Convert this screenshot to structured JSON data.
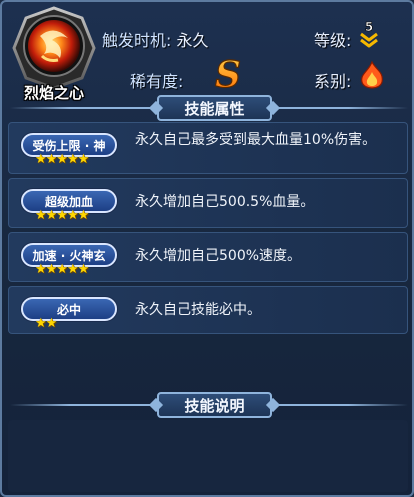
{
  "skill": {
    "name": "烈焰之心",
    "icon": "fire-orb-icon"
  },
  "header": {
    "trigger_label": "触发时机:",
    "trigger_value": "永久",
    "level_label": "等级:",
    "level_value": "5",
    "rarity_label": "稀有度:",
    "rarity_value": "S",
    "series_label": "系别:",
    "series_icon": "fire-element-icon"
  },
  "sections": {
    "attributes_title": "技能属性",
    "description_title": "技能说明"
  },
  "attributes": [
    {
      "name": "受伤上限 · 神",
      "stars": "★★★★★",
      "star_count": 5,
      "desc": "永久自己最多受到最大血量10%伤害。"
    },
    {
      "name": "超级加血",
      "stars": "★★★★★",
      "star_count": 5,
      "desc": "永久增加自己500.5%血量。"
    },
    {
      "name": "加速 · 火神玄",
      "stars": "★★★★★",
      "star_count": 5,
      "desc": "永久增加自己500%速度。"
    },
    {
      "name": "必中",
      "stars": "★★",
      "star_count": 2,
      "desc": "永久自己技能必中。"
    }
  ],
  "colors": {
    "panel_bg": "#1d3050",
    "pill_blue": "#2a55a0",
    "star_gold": "#ffd700",
    "rarity_orange": "#ff8c1a"
  }
}
